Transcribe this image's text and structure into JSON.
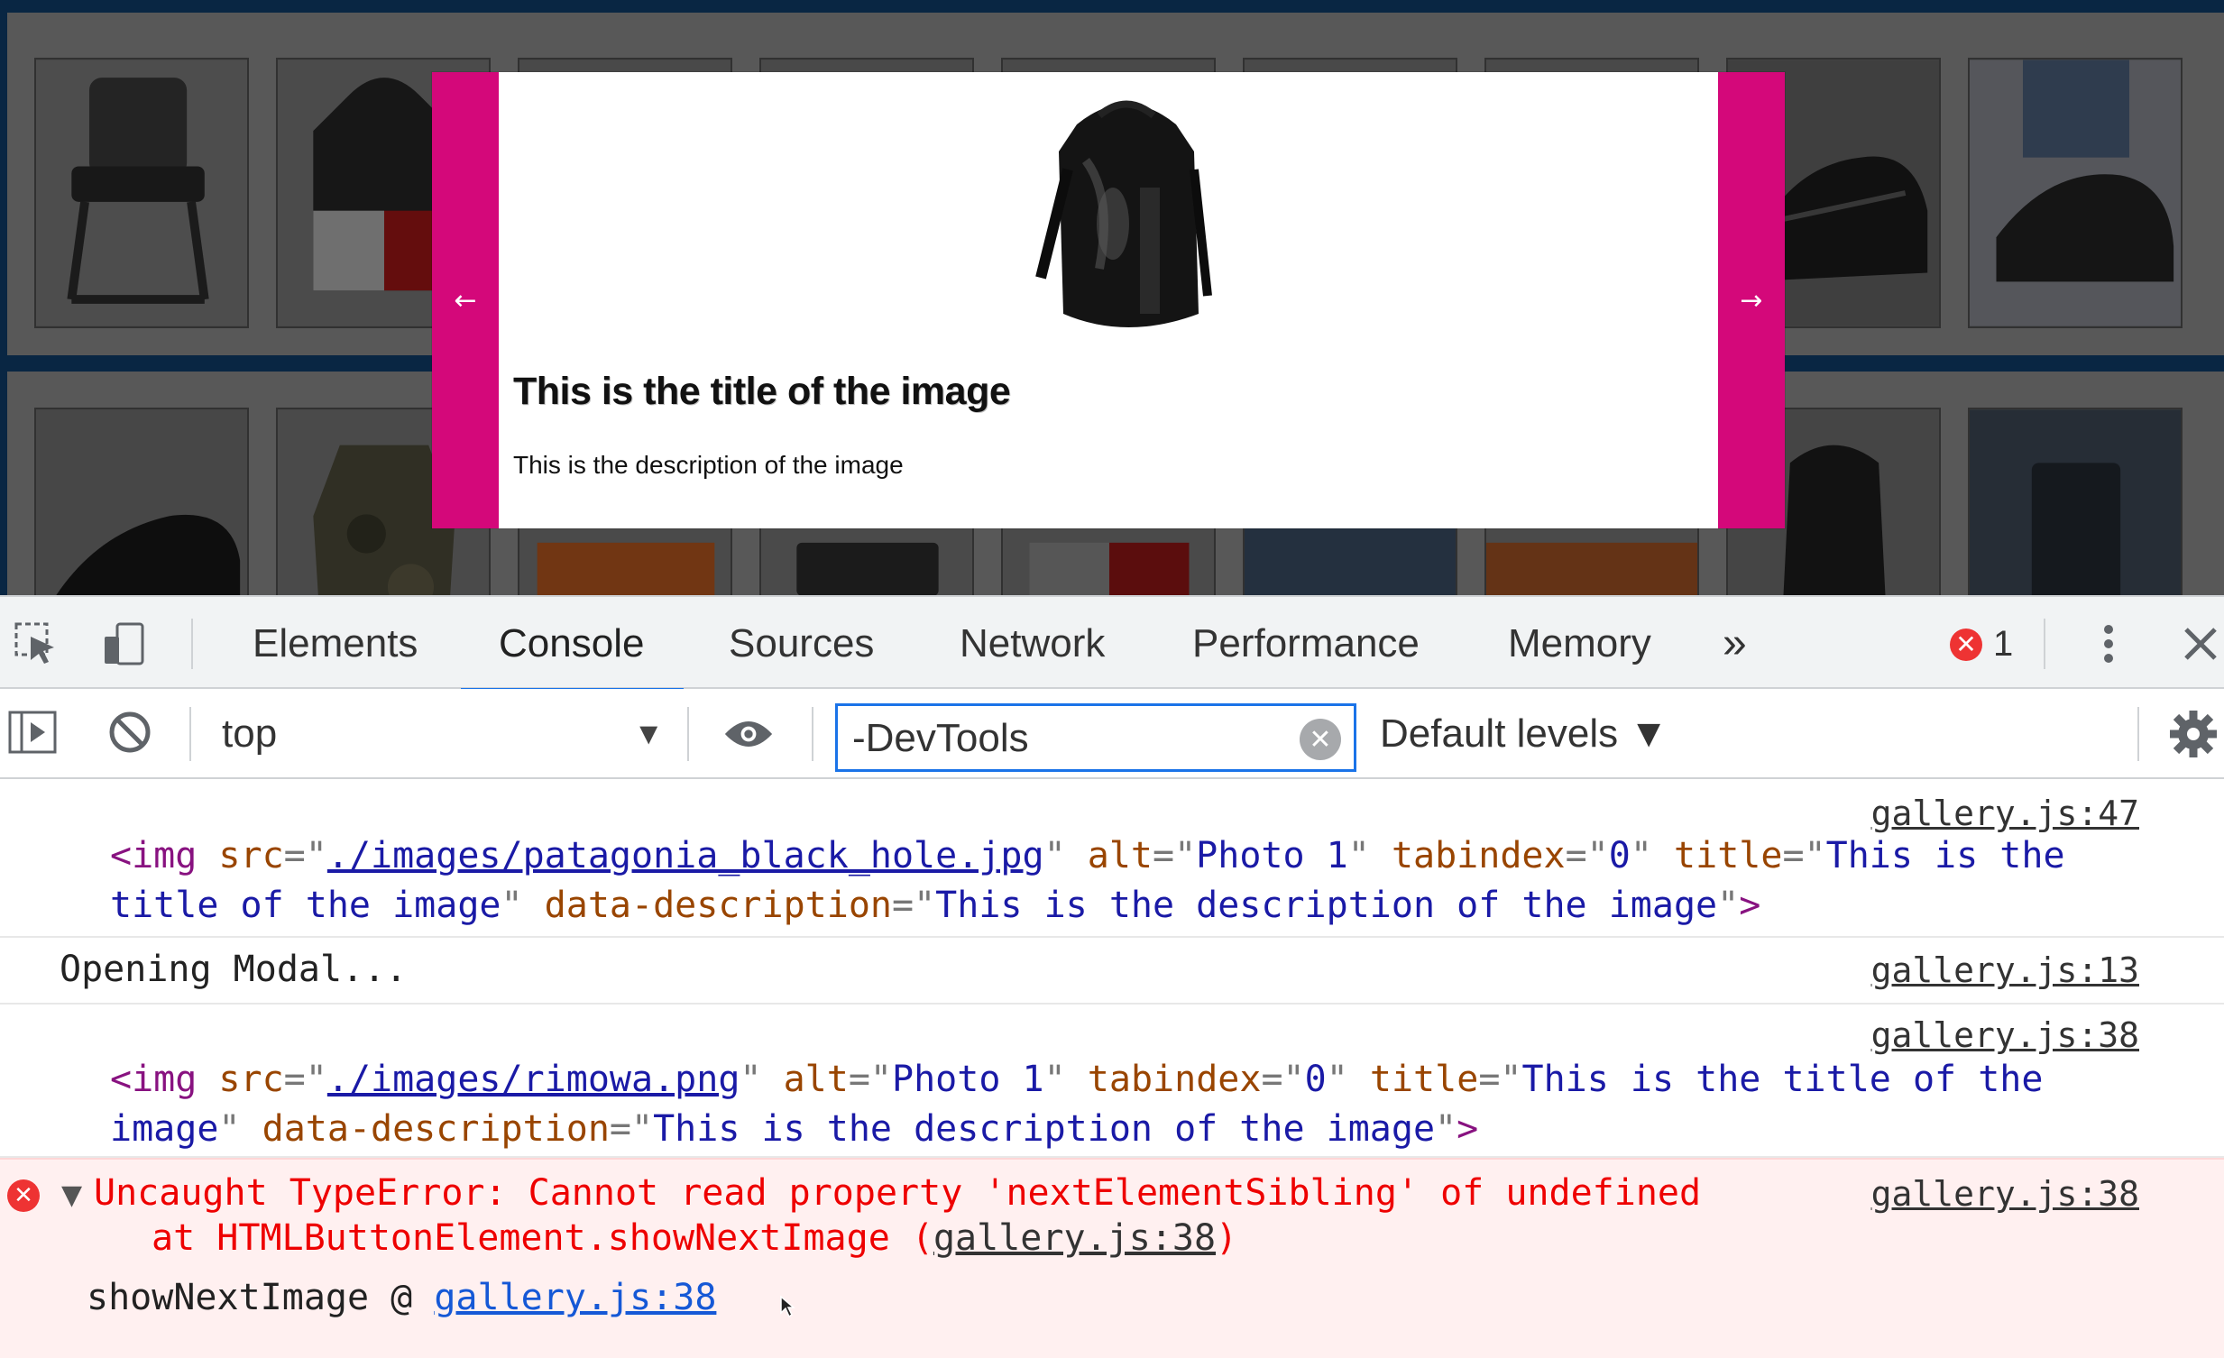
{
  "gallery": {
    "tiles_row1": [
      "chair",
      "hoodie",
      "product",
      "product",
      "product",
      "product",
      "product",
      "sneaker",
      "sneaker-on-foot"
    ],
    "tiles_row2": [
      "black-sneaker",
      "camo-jacket",
      "cooler",
      "chair",
      "hoodie",
      "denim",
      "leather-case",
      "backpack",
      "suitcase"
    ]
  },
  "modal": {
    "prev_label": "←",
    "next_label": "→",
    "image_alt": "Photo 1",
    "title": "This is the title of the image",
    "description": "This is the description of the image"
  },
  "devtools": {
    "tabs": [
      "Elements",
      "Console",
      "Sources",
      "Network",
      "Performance",
      "Memory"
    ],
    "active_tab": "Console",
    "more_tabs": "»",
    "error_count": "1",
    "context": "top",
    "filter_value": "-DevTools",
    "levels": "Default levels ▼"
  },
  "console": {
    "m1": {
      "source": "gallery.js:47",
      "open": "<img",
      "src_attr": "src",
      "src_val": "./images/patagonia_black_hole.jpg",
      "alt_attr": "alt",
      "alt_val": "Photo 1",
      "tab_attr": "tabindex",
      "tab_val": "0",
      "title_attr": "title",
      "title_val_a": "This is the",
      "title_val_b": "title of the image",
      "desc_attr": "data-description",
      "desc_val": "This is the description of the image"
    },
    "m2": {
      "text": "Opening Modal...",
      "source": "gallery.js:13"
    },
    "m3": {
      "source": "gallery.js:38",
      "open": "<img",
      "src_attr": "src",
      "src_val": "./images/rimowa.png",
      "alt_attr": "alt",
      "alt_val": "Photo 1",
      "tab_attr": "tabindex",
      "tab_val": "0",
      "title_attr": "title",
      "title_val_a": "This is the title of the",
      "title_val_b": "image",
      "desc_attr": "data-description",
      "desc_val": "This is the description of the image"
    },
    "m4": {
      "error": "Uncaught TypeError: Cannot read property 'nextElementSibling' of undefined",
      "at_text": "at HTMLButtonElement.showNextImage (",
      "at_link": "gallery.js:38",
      "at_close": ")",
      "source": "gallery.js:38",
      "stack_fn": "showNextImage @",
      "stack_link": "gallery.js:38"
    }
  },
  "colors": {
    "accent": "#1a73e8",
    "modal_nav": "#d4087a",
    "error": "#e00000"
  }
}
